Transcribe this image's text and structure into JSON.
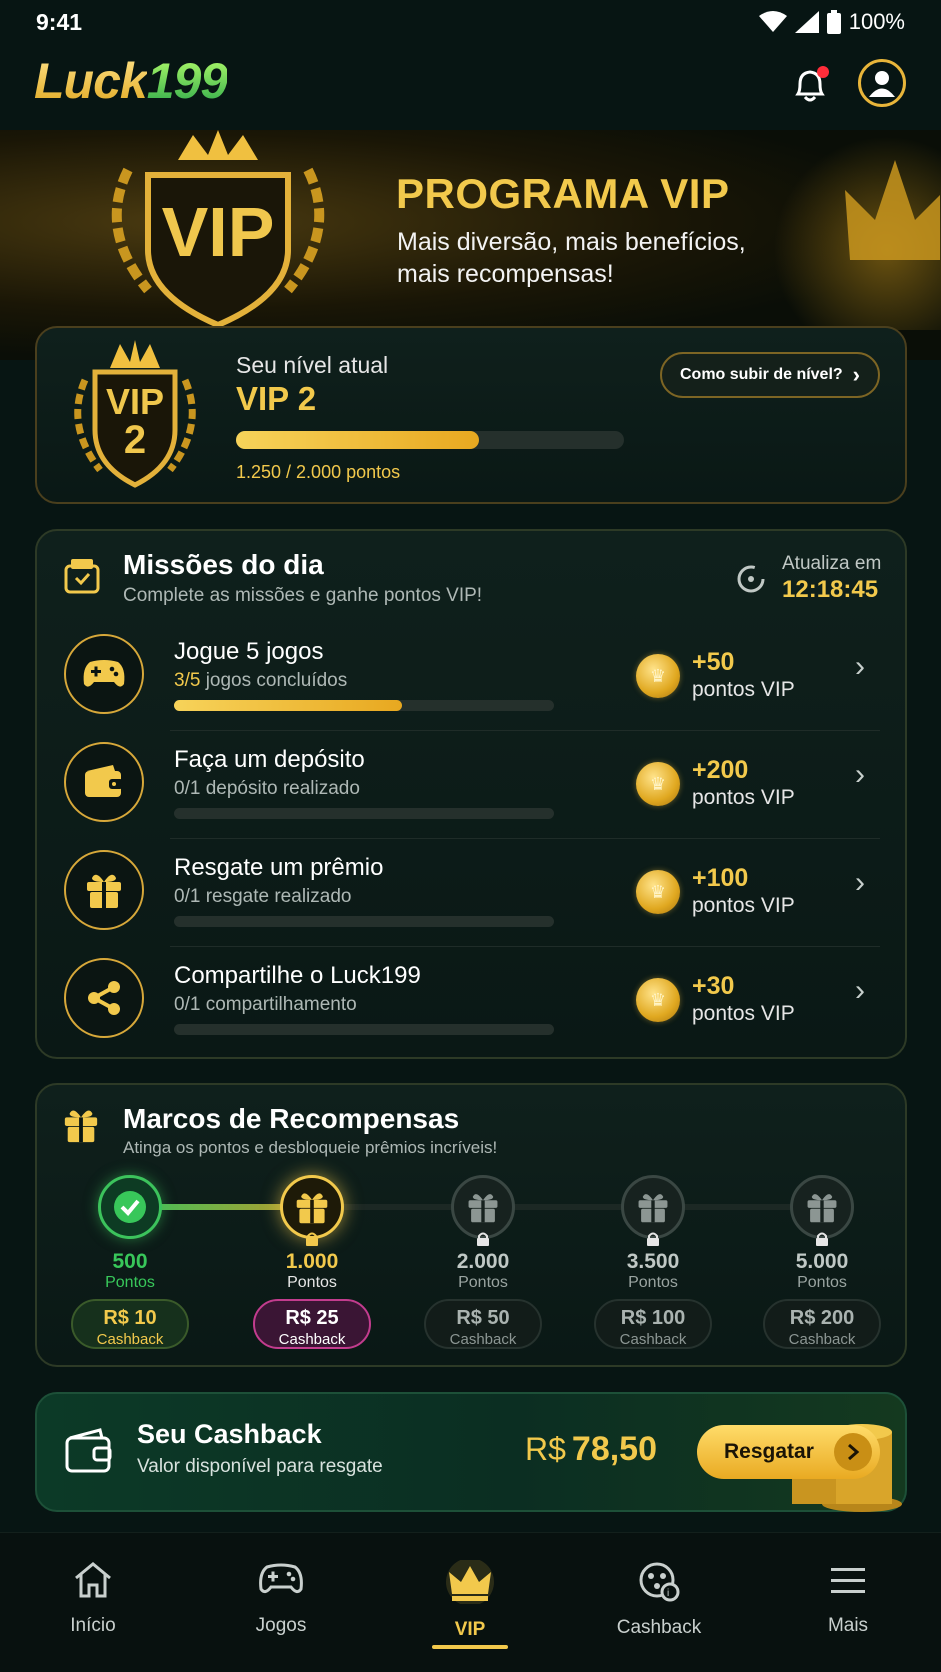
{
  "status_bar": {
    "time": "9:41",
    "battery": "100%"
  },
  "header": {
    "logo_part1": "Luck",
    "logo_part2": "199"
  },
  "banner": {
    "badge_text": "VIP",
    "title": "PROGRAMA VIP",
    "subtitle": "Mais diversão, mais benefícios, mais recompensas!"
  },
  "level": {
    "badge_line1": "VIP",
    "badge_line2": "2",
    "label": "Seu nível atual",
    "name": "VIP 2",
    "points_text": "1.250 / 2.000 pontos",
    "progress": 0.625,
    "how_button": "Como subir de nível?"
  },
  "missions": {
    "title": "Missões do dia",
    "subtitle": "Complete as missões e ganhe pontos VIP!",
    "updates_label": "Atualiza em",
    "updates_time": "12:18:45",
    "items": [
      {
        "icon": "gamepad-icon",
        "title": "Jogue 5 jogos",
        "count": "3/5",
        "sub": "jogos concluídos",
        "progress": 0.6,
        "points": "+50",
        "unit": "pontos VIP"
      },
      {
        "icon": "wallet-icon",
        "title": "Faça um depósito",
        "count": "0/1",
        "sub": "depósito realizado",
        "progress": 0,
        "points": "+200",
        "unit": "pontos VIP"
      },
      {
        "icon": "gift-icon",
        "title": "Resgate um prêmio",
        "count": "0/1",
        "sub": "resgate realizado",
        "progress": 0,
        "points": "+100",
        "unit": "pontos VIP"
      },
      {
        "icon": "share-icon",
        "title": "Compartilhe o Luck199",
        "count": "0/1",
        "sub": "compartilhamento",
        "progress": 0,
        "points": "+30",
        "unit": "pontos VIP"
      }
    ]
  },
  "milestones": {
    "title": "Marcos de Recompensas",
    "subtitle": "Atinga os pontos e desbloqueie prêmios incríveis!",
    "unit": "Pontos",
    "items": [
      {
        "value": "500",
        "reward": "R$ 10",
        "reward_label": "Cashback",
        "state": "done"
      },
      {
        "value": "1.000",
        "reward": "R$ 25",
        "reward_label": "Cashback",
        "state": "current"
      },
      {
        "value": "2.000",
        "reward": "R$ 50",
        "reward_label": "Cashback",
        "state": "locked"
      },
      {
        "value": "3.500",
        "reward": "R$ 100",
        "reward_label": "Cashback",
        "state": "locked"
      },
      {
        "value": "5.000",
        "reward": "R$ 200",
        "reward_label": "Cashback",
        "state": "locked"
      }
    ]
  },
  "cashback": {
    "title": "Seu Cashback",
    "subtitle": "Valor disponível para resgate",
    "currency": "R$",
    "amount": "78,50",
    "button": "Resgatar"
  },
  "nav": {
    "items": [
      {
        "label": "Início",
        "icon": "home-icon"
      },
      {
        "label": "Jogos",
        "icon": "gamepad-icon"
      },
      {
        "label": "VIP",
        "icon": "crown-icon",
        "active": true
      },
      {
        "label": "Cashback",
        "icon": "cashback-icon"
      },
      {
        "label": "Mais",
        "icon": "menu-icon"
      }
    ]
  },
  "colors": {
    "accent": "#f2c94c",
    "success": "#38c75a",
    "background": "#071513",
    "pink": "#c23c8e"
  }
}
